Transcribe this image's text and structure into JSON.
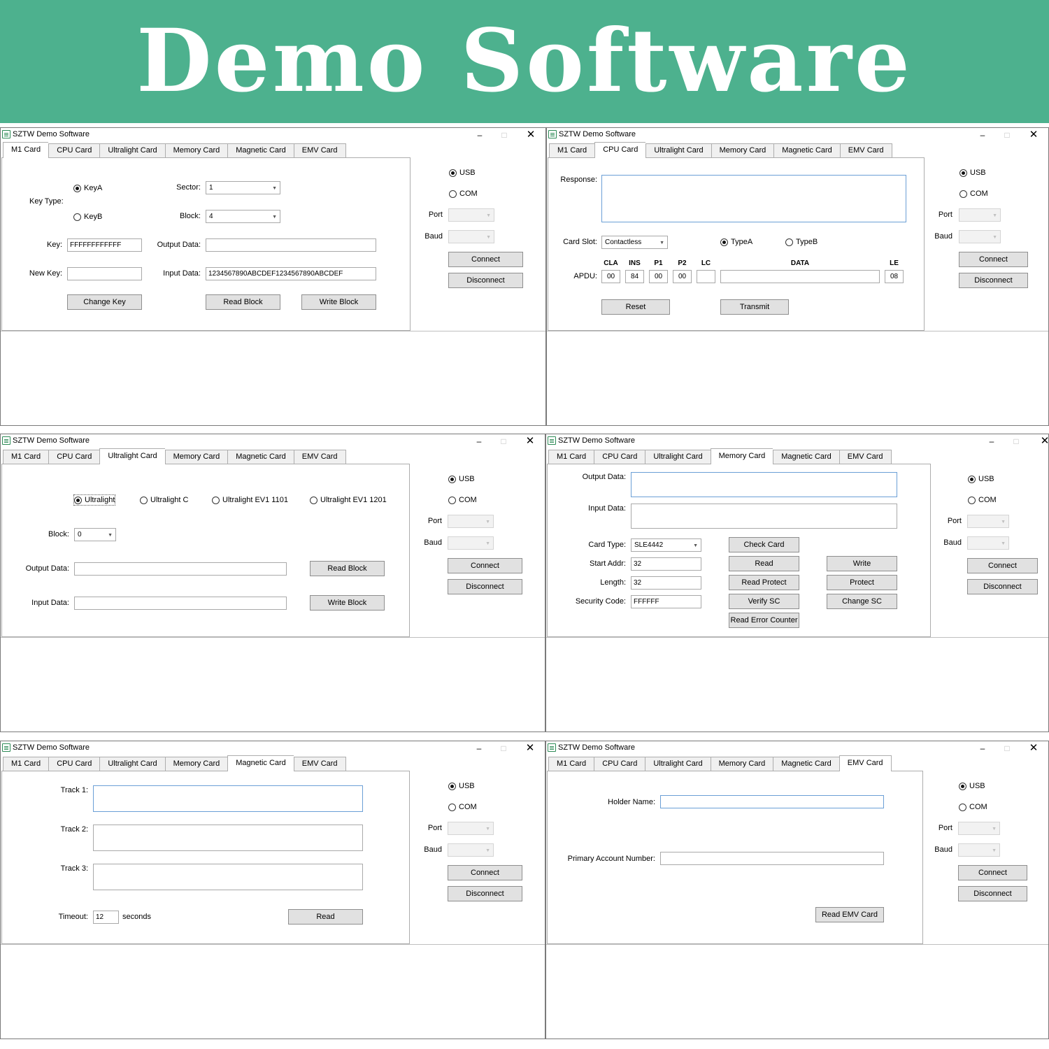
{
  "banner": {
    "title": "Demo Software"
  },
  "window": {
    "title": "SZTW Demo Software",
    "minimize": "–",
    "maximize": "□",
    "close": "✕"
  },
  "tabs": [
    "M1 Card",
    "CPU Card",
    "Ultralight Card",
    "Memory Card",
    "Magnetic Card",
    "EMV Card"
  ],
  "connection": {
    "usb_label": "USB",
    "com_label": "COM",
    "port_label": "Port",
    "baud_label": "Baud",
    "connect_label": "Connect",
    "disconnect_label": "Disconnect",
    "selected": "USB"
  },
  "m1": {
    "active_tab": "M1 Card",
    "key_type_label": "Key Type:",
    "keya_label": "KeyA",
    "keyb_label": "KeyB",
    "sector_label": "Sector:",
    "sector_value": "1",
    "block_label": "Block:",
    "block_value": "4",
    "key_label": "Key:",
    "key_value": "FFFFFFFFFFFF",
    "output_label": "Output Data:",
    "new_key_label": "New Key:",
    "input_label": "Input Data:",
    "input_value": "1234567890ABCDEF1234567890ABCDEF",
    "change_key_button": "Change Key",
    "read_block_button": "Read Block",
    "write_block_button": "Write Block"
  },
  "cpu": {
    "active_tab": "CPU Card",
    "response_label": "Response:",
    "card_slot_label": "Card Slot:",
    "card_slot_value": "Contactless",
    "typea_label": "TypeA",
    "typeb_label": "TypeB",
    "apdu_label": "APDU:",
    "headers": {
      "cla": "CLA",
      "ins": "INS",
      "p1": "P1",
      "p2": "P2",
      "lc": "LC",
      "data": "DATA",
      "le": "LE"
    },
    "values": {
      "cla": "00",
      "ins": "84",
      "p1": "00",
      "p2": "00",
      "lc": "",
      "data": "",
      "le": "08"
    },
    "reset_button": "Reset",
    "transmit_button": "Transmit"
  },
  "ultralight": {
    "active_tab": "Ultralight Card",
    "opt_ultralight": "Ultralight",
    "opt_ultralight_c": "Ultralight C",
    "opt_ev1_1101": "Ultralight EV1 1101",
    "opt_ev1_1201": "Ultralight EV1 1201",
    "block_label": "Block:",
    "block_value": "0",
    "output_label": "Output Data:",
    "input_label": "Input Data:",
    "read_block_button": "Read Block",
    "write_block_button": "Write Block"
  },
  "memory": {
    "active_tab": "Memory Card",
    "output_label": "Output Data:",
    "input_label": "Input Data:",
    "card_type_label": "Card Type:",
    "card_type_value": "SLE4442",
    "start_addr_label": "Start Addr:",
    "start_addr_value": "32",
    "length_label": "Length:",
    "length_value": "32",
    "security_code_label": "Security Code:",
    "security_code_value": "FFFFFF",
    "check_card_button": "Check Card",
    "read_button": "Read",
    "write_button": "Write",
    "read_protect_button": "Read Protect",
    "protect_button": "Protect",
    "verify_sc_button": "Verify SC",
    "change_sc_button": "Change SC",
    "read_error_counter_button": "Read Error Counter"
  },
  "magnetic": {
    "active_tab": "Magnetic Card",
    "track1_label": "Track 1:",
    "track2_label": "Track 2:",
    "track3_label": "Track 3:",
    "timeout_label": "Timeout:",
    "timeout_value": "12",
    "seconds_label": "seconds",
    "read_button": "Read"
  },
  "emv": {
    "active_tab": "EMV Card",
    "holder_name_label": "Holder Name:",
    "pan_label": "Primary Account Number:",
    "read_emv_button": "Read EMV Card"
  }
}
